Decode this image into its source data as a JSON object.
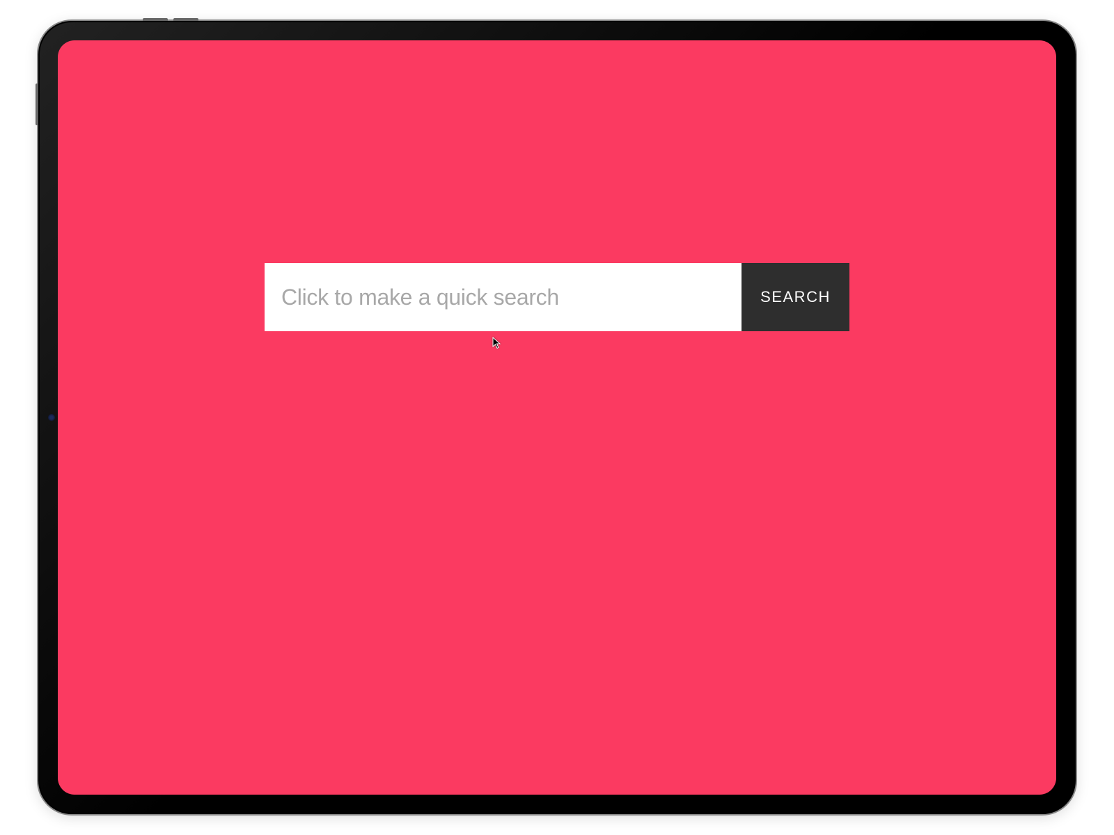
{
  "search": {
    "placeholder": "Click to make a quick search",
    "value": "",
    "button_label": "SEARCH"
  },
  "colors": {
    "screen_bg": "#fb3a61",
    "button_bg": "#2e2e2e",
    "input_bg": "#ffffff",
    "placeholder": "#a8a8a8"
  }
}
